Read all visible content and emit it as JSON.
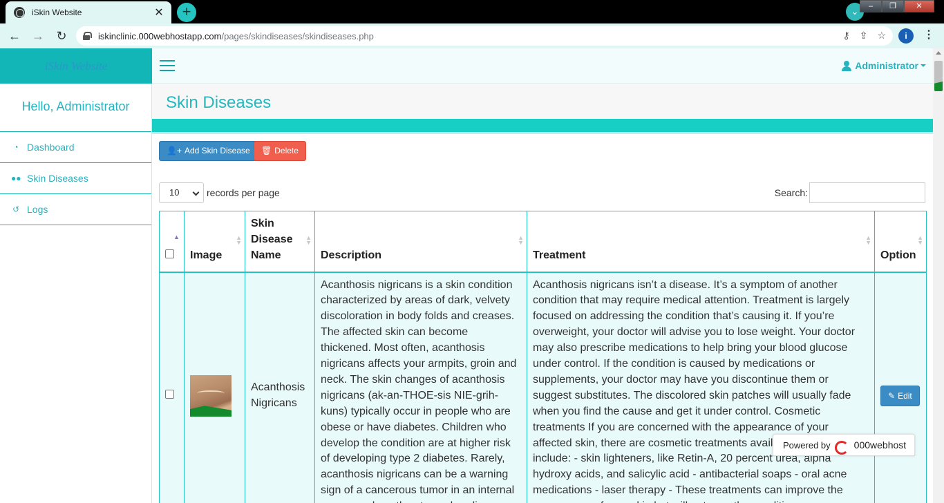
{
  "browser": {
    "tab_title": "iSkin Website",
    "tab_close": "✕",
    "new_tab": "+",
    "url_domain": "iskinclinic.000webhostapp.com",
    "url_path": "/pages/skindiseases/skindiseases.php",
    "profile_initial": "i",
    "window_controls": [
      "–",
      "❐",
      "✕"
    ]
  },
  "app": {
    "brand": "iSkin Website",
    "user_menu": "Administrator",
    "greeting": "Hello, Administrator"
  },
  "sidebar": {
    "items": [
      {
        "label": "Dashboard",
        "icon": "dashboard-icon"
      },
      {
        "label": "Skin Diseases",
        "icon": "users-icon"
      },
      {
        "label": "Logs",
        "icon": "history-icon"
      }
    ]
  },
  "page": {
    "title": "Skin Diseases",
    "add_button": "Add Skin Disease",
    "delete_button": "Delete",
    "length_value": "10",
    "length_label": "records per page",
    "search_label": "Search:"
  },
  "table": {
    "columns": [
      "Image",
      "Skin Disease Name",
      "Description",
      "Treatment",
      "Option"
    ],
    "rows": [
      {
        "name": "Acanthosis Nigricans",
        "description": "Acanthosis nigricans is a skin condition characterized by areas of dark, velvety discoloration in body folds and creases. The affected skin can become thickened. Most often, acanthosis nigricans affects your armpits, groin and neck. The skin changes of acanthosis nigricans (ak-an-THOE-sis NIE-grih-kuns) typically occur in people who are obese or have diabetes. Children who develop the condition are at higher risk of developing type 2 diabetes. Rarely, acanthosis nigricans can be a warning sign of a cancerous tumor in an internal organ, such as the stomach or liver.",
        "treatment": "Acanthosis nigricans isn’t a disease. It’s a symptom of another condition that may require medical attention. Treatment is largely focused on addressing the condition that’s causing it. If you’re overweight, your doctor will advise you to lose weight. Your doctor may also prescribe medications to help bring your blood glucose under control. If the condition is caused by medications or supplements, your doctor may have you discontinue them or suggest substitutes. The discolored skin patches will usually fade when you find the cause and get it under control. Cosmetic treatments If you are concerned with the appearance of your affected skin, there are cosmetic treatments available. Treatments include: - skin lighteners, like Retin-A, 20 percent urea, alpha hydroxy acids, and salicylic acid - antibacterial soaps - oral acne medications - laser therapy - These treatments can improve the appearance of your skin but will not cure the condition.",
        "option": "Edit"
      }
    ]
  },
  "footer_badge": {
    "prefix": "Powered by",
    "brand": "000webhost"
  }
}
